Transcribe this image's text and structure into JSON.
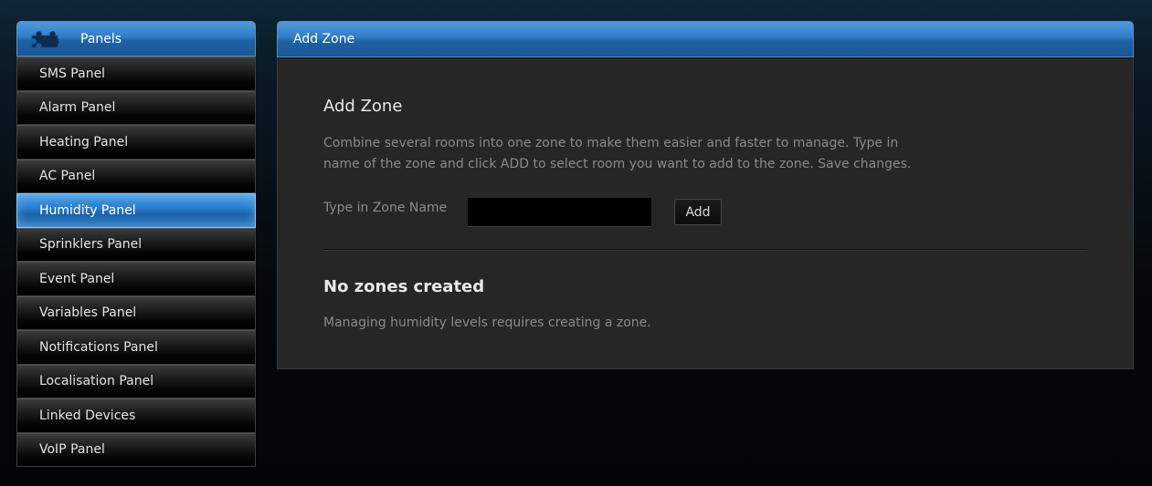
{
  "sidebar": {
    "header": {
      "icon": "puzzle-icon",
      "title": "Panels"
    },
    "items": [
      {
        "label": "SMS Panel",
        "active": false
      },
      {
        "label": "Alarm Panel",
        "active": false
      },
      {
        "label": "Heating Panel",
        "active": false
      },
      {
        "label": "AC Panel",
        "active": false
      },
      {
        "label": "Humidity Panel",
        "active": true
      },
      {
        "label": "Sprinklers Panel",
        "active": false
      },
      {
        "label": "Event Panel",
        "active": false
      },
      {
        "label": "Variables Panel",
        "active": false
      },
      {
        "label": "Notifications Panel",
        "active": false
      },
      {
        "label": "Localisation Panel",
        "active": false
      },
      {
        "label": "Linked Devices",
        "active": false
      },
      {
        "label": "VoIP Panel",
        "active": false
      }
    ]
  },
  "main": {
    "header_title": "Add Zone",
    "section_title": "Add Zone",
    "description": "Combine several rooms into one zone to make them easier and faster to manage. Type in name of the zone and click ADD to select room you want to add to the zone. Save changes.",
    "form": {
      "label": "Type in Zone Name",
      "input_value": "",
      "add_button_label": "Add"
    },
    "zones": {
      "title": "No zones created",
      "note": "Managing humidity levels requires creating a zone."
    }
  },
  "colors": {
    "accent_blue": "#2f7cc4",
    "panel_background": "#262626",
    "muted_text": "#8a8a8a"
  }
}
